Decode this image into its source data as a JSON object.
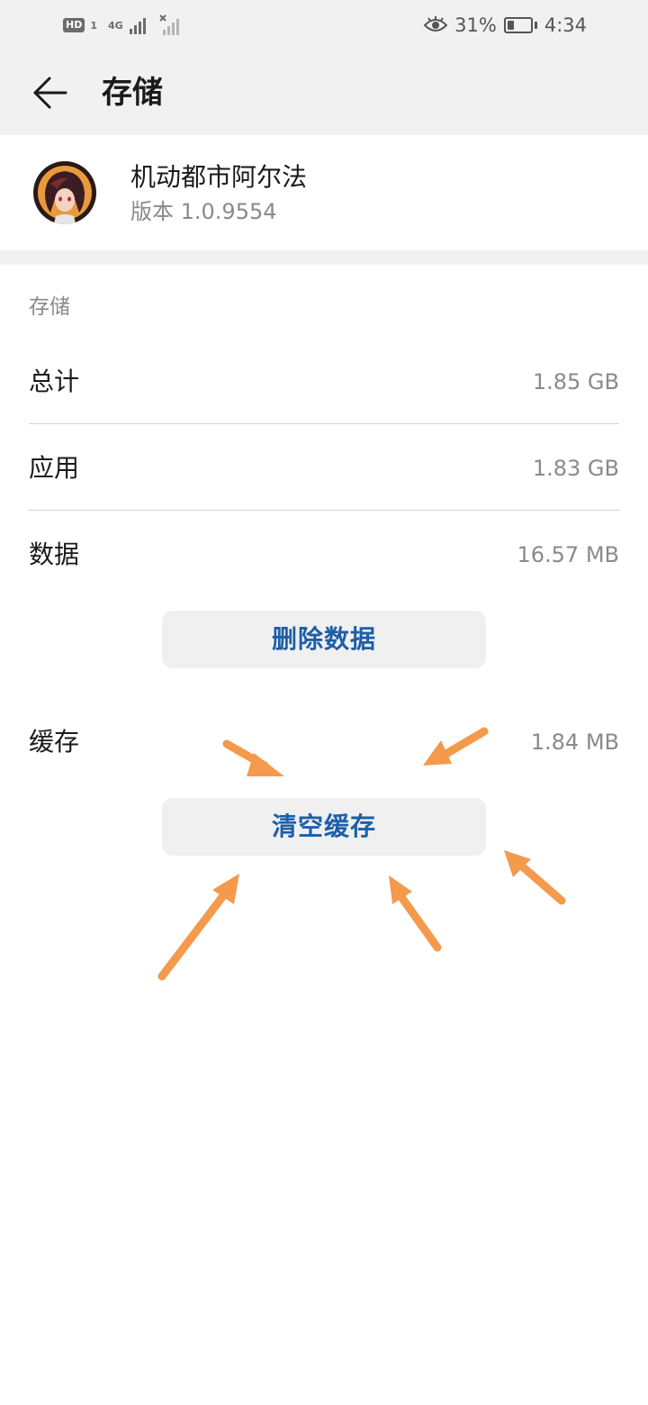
{
  "status_bar": {
    "hd_label": "HD",
    "sim_label": "1",
    "network_label": "4G",
    "battery_percent": "31%",
    "battery_level": 0.31,
    "time": "4:34"
  },
  "app_bar": {
    "back_icon": "arrow-left-icon",
    "title": "存储"
  },
  "app_info": {
    "icon": "app-avatar-icon",
    "name": "机动都市阿尔法",
    "version": "版本 1.0.9554"
  },
  "storage": {
    "section_title": "存储",
    "total_label": "总计",
    "total_value": "1.85 GB",
    "app_label": "应用",
    "app_value": "1.83 GB",
    "data_label": "数据",
    "data_value": "16.57 MB",
    "delete_data_button": "删除数据",
    "cache_label": "缓存",
    "cache_value": "1.84 MB",
    "clear_cache_button": "清空缓存"
  },
  "annotation": {
    "arrow_color": "#f39a4c",
    "accent_color": "#1d5fa6"
  }
}
